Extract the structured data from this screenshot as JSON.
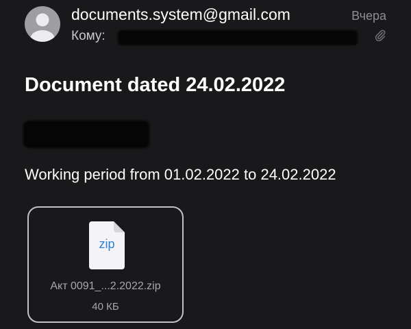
{
  "header": {
    "sender": "documents.system@gmail.com",
    "to_label": "Кому:",
    "date": "Вчера",
    "icons": {
      "avatar": "person-avatar-icon",
      "attachment_indicator": "paperclip-icon"
    }
  },
  "message": {
    "subject": "Document dated 24.02.2022",
    "body": "Working period from 01.02.2022 to 24.02.2022"
  },
  "attachment": {
    "type_label": "zip",
    "file_name": "Акт 0091_...2.2022.zip",
    "file_size": "40 КБ",
    "icon": "zip-file-icon"
  },
  "colors": {
    "background": "#19191b",
    "text_primary": "#ffffff",
    "text_secondary": "#8e8e93",
    "zip_accent": "#2f7fd8"
  }
}
